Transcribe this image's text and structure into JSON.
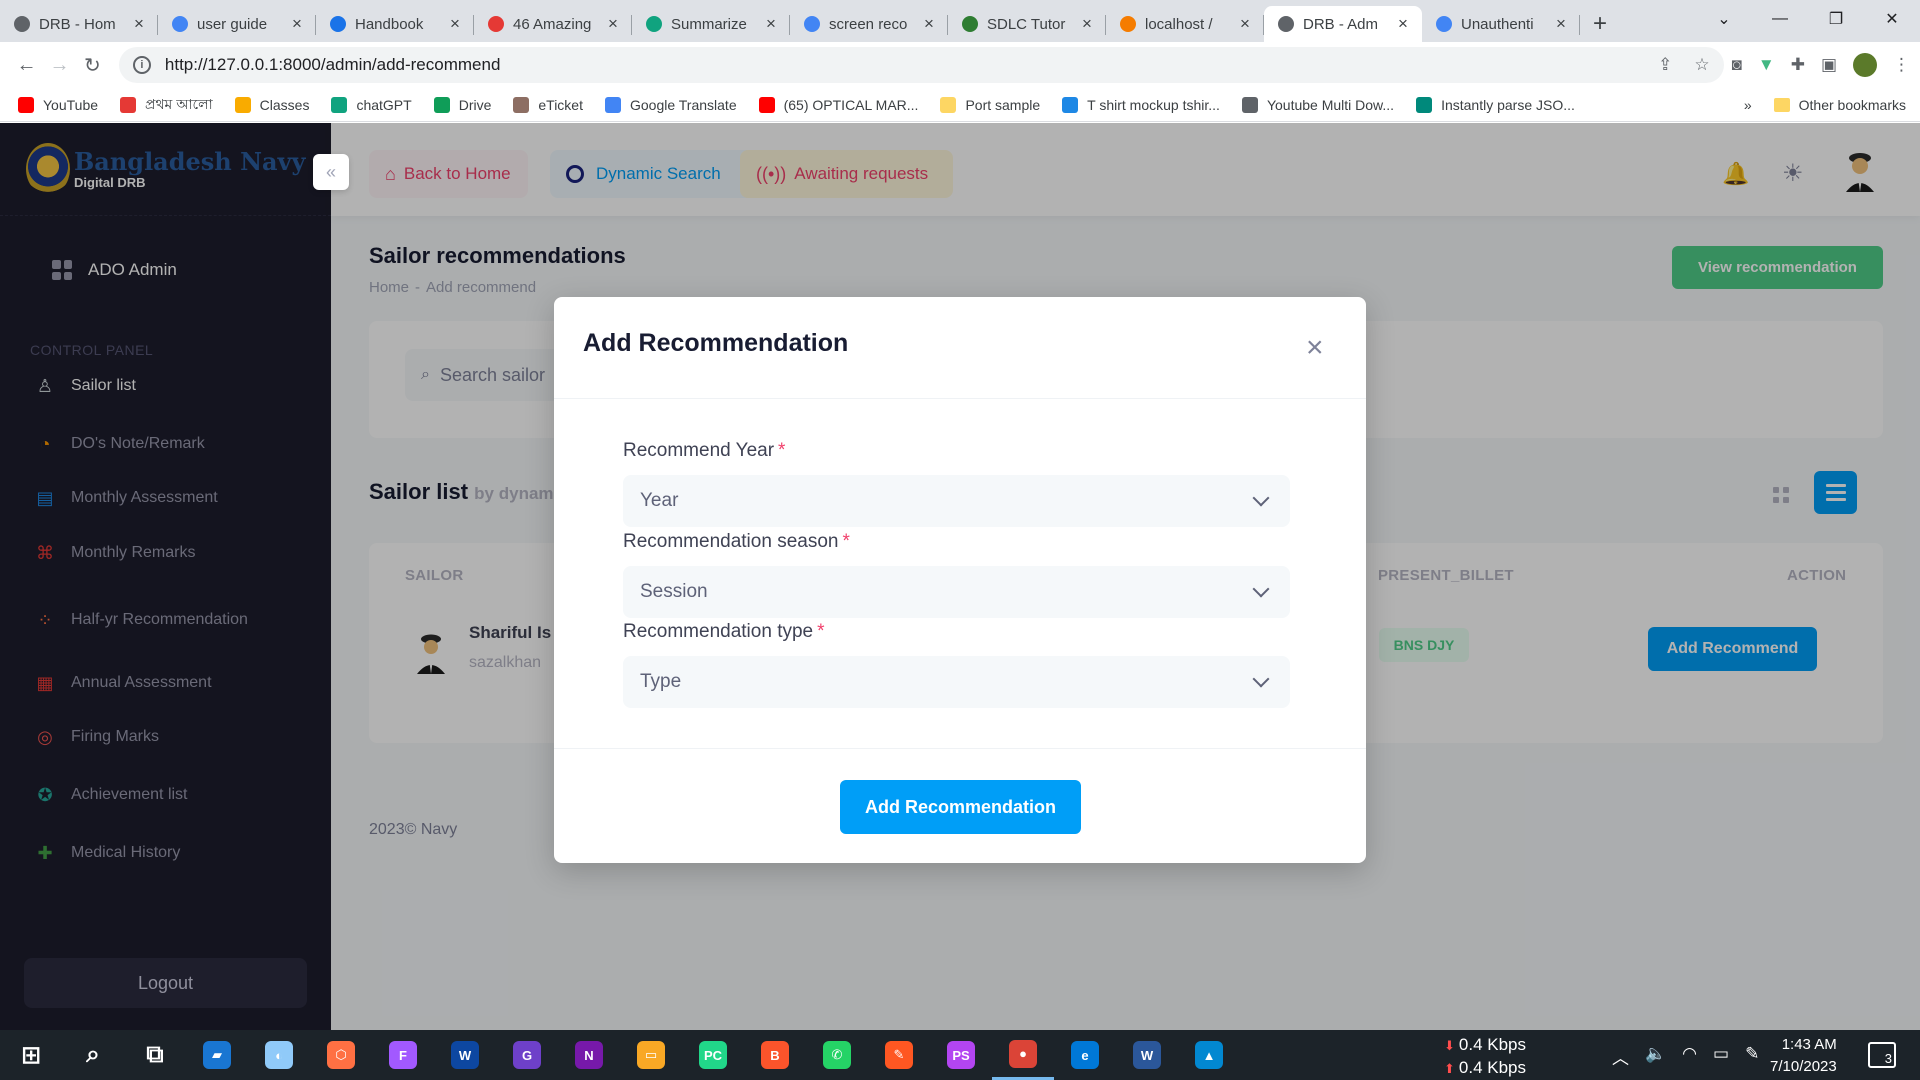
{
  "browser": {
    "tabs": [
      {
        "title": "DRB - Hom",
        "favicon": "globe-icon",
        "color": "#5f6368"
      },
      {
        "title": "user guide",
        "favicon": "google-icon",
        "color": "#4285f4"
      },
      {
        "title": "Handbook",
        "favicon": "table-icon",
        "color": "#1a73e8"
      },
      {
        "title": "46 Amazing",
        "favicon": "a-icon",
        "color": "#e53935"
      },
      {
        "title": "Summarize",
        "favicon": "chatgpt-icon",
        "color": "#10a37f"
      },
      {
        "title": "screen reco",
        "favicon": "google-icon",
        "color": "#4285f4"
      },
      {
        "title": "SDLC Tutor",
        "favicon": "leaf-icon",
        "color": "#2e7d32"
      },
      {
        "title": "localhost /",
        "favicon": "pma-icon",
        "color": "#f57c00"
      },
      {
        "title": "DRB - Adm",
        "favicon": "globe-icon",
        "color": "#5f6368"
      },
      {
        "title": "Unauthenti",
        "favicon": "google-icon",
        "color": "#4285f4"
      }
    ],
    "active_tab_index": 8,
    "url": "http://127.0.0.1:8000/admin/add-recommend",
    "bookmarks": [
      {
        "label": "YouTube",
        "icon": "youtube-icon",
        "color": "#ff0000"
      },
      {
        "label": "প্রথম আলো",
        "icon": "prothomalo-icon",
        "color": "#e53935"
      },
      {
        "label": "Classes",
        "icon": "classroom-icon",
        "color": "#f9ab00"
      },
      {
        "label": "chatGPT",
        "icon": "chatgpt-icon",
        "color": "#10a37f"
      },
      {
        "label": "Drive",
        "icon": "drive-icon",
        "color": "#0f9d58"
      },
      {
        "label": "eTicket",
        "icon": "ticket-icon",
        "color": "#8d6e63"
      },
      {
        "label": "Google Translate",
        "icon": "translate-icon",
        "color": "#4285f4"
      },
      {
        "label": "(65) OPTICAL MAR...",
        "icon": "youtube-icon",
        "color": "#ff0000"
      },
      {
        "label": "Port sample",
        "icon": "folder-icon",
        "color": "#fdd663"
      },
      {
        "label": "T shirt mockup tshir...",
        "icon": "shirt-icon",
        "color": "#1e88e5"
      },
      {
        "label": "Youtube Multi Dow...",
        "icon": "globe-icon",
        "color": "#5f6368"
      },
      {
        "label": "Instantly parse JSO...",
        "icon": "qt-icon",
        "color": "#00897b"
      }
    ],
    "more_bookmarks": "»",
    "other_bookmarks": "Other bookmarks"
  },
  "sidebar": {
    "brand_title": "Bangladesh Navy",
    "brand_subtitle": "Digital DRB",
    "dashboard_label": "ADO Admin",
    "section_label": "CONTROL PANEL",
    "items": [
      {
        "label": "Sailor list",
        "icon": "sailor-icon",
        "active": true
      },
      {
        "label": "DO's Note/Remark",
        "icon": "rss-icon"
      },
      {
        "label": "Monthly Assessment",
        "icon": "chart-icon"
      },
      {
        "label": "Monthly Remarks",
        "icon": "command-icon"
      },
      {
        "label": "Half-yr Recommendation",
        "icon": "dots-icon"
      },
      {
        "label": "Annual Assessment",
        "icon": "calendar-icon"
      },
      {
        "label": "Firing Marks",
        "icon": "target-icon"
      },
      {
        "label": "Achievement list",
        "icon": "medal-icon"
      },
      {
        "label": "Medical History",
        "icon": "medical-icon"
      }
    ],
    "logout_label": "Logout"
  },
  "header": {
    "back_label": "Back to Home",
    "dynamic_search_label": "Dynamic Search",
    "awaiting_label": "Awaiting requests"
  },
  "page": {
    "title": "Sailor recommendations",
    "breadcrumb_home": "Home",
    "breadcrumb_sep": "-",
    "breadcrumb_current": "Add recommend",
    "view_recommendation_label": "View recommendation",
    "search_placeholder": "Search sailor",
    "list_title": "Sailor list",
    "list_subtitle": "by dynam",
    "columns": {
      "sailor": "SAILOR",
      "present_billet": "PRESENT_BILLET",
      "action": "ACTION"
    },
    "rows": [
      {
        "name": "Shariful Is",
        "sub": "sazalkhan",
        "billet": "BNS DJY",
        "action": "Add Recommend"
      }
    ],
    "footer": "2023© Navy"
  },
  "modal": {
    "title": "Add Recommendation",
    "close": "×",
    "fields": [
      {
        "label": "Recommend Year",
        "required": "*",
        "value": "Year"
      },
      {
        "label": "Recommendation season",
        "required": "*",
        "value": "Session"
      },
      {
        "label": "Recommendation type",
        "required": "*",
        "value": "Type"
      }
    ],
    "submit_label": "Add Recommendation"
  },
  "taskbar": {
    "apps": [
      {
        "name": "start-icon",
        "glyph": "⊞",
        "color": "transparent"
      },
      {
        "name": "search-icon",
        "glyph": "⌕",
        "color": "transparent"
      },
      {
        "name": "task-view-icon",
        "glyph": "⧉",
        "color": "transparent"
      },
      {
        "name": "app-1-icon",
        "glyph": "▰",
        "color": "#1976d2"
      },
      {
        "name": "app-2-icon",
        "glyph": "◐",
        "color": "#90caf9"
      },
      {
        "name": "app-3-icon",
        "glyph": "⬡",
        "color": "#ff7043"
      },
      {
        "name": "figma-icon",
        "glyph": "F",
        "color": "#a259ff"
      },
      {
        "name": "app-4-icon",
        "glyph": "W",
        "color": "#0d47a1"
      },
      {
        "name": "github-icon",
        "glyph": "G",
        "color": "#6e40c9"
      },
      {
        "name": "onenote-icon",
        "glyph": "N",
        "color": "#7719aa"
      },
      {
        "name": "file-explorer-icon",
        "glyph": "▭",
        "color": "#f9a825"
      },
      {
        "name": "pycharm-icon",
        "glyph": "PC",
        "color": "#21d789"
      },
      {
        "name": "brave-icon",
        "glyph": "B",
        "color": "#fb542b"
      },
      {
        "name": "whatsapp-icon",
        "glyph": "✆",
        "color": "#25d366"
      },
      {
        "name": "app-5-icon",
        "glyph": "✎",
        "color": "#ff5722"
      },
      {
        "name": "phpstorm-icon",
        "glyph": "PS",
        "color": "#b345f1"
      },
      {
        "name": "chrome-icon",
        "glyph": "●",
        "color": "#db4437"
      },
      {
        "name": "edge-icon",
        "glyph": "e",
        "color": "#0078d7"
      },
      {
        "name": "word-icon",
        "glyph": "W",
        "color": "#2b579a"
      },
      {
        "name": "photos-icon",
        "glyph": "▲",
        "color": "#0288d1"
      }
    ],
    "net_down": "0.4 Kbps",
    "net_up": "0.4 Kbps",
    "time": "1:43 AM",
    "date": "7/10/2023",
    "notifications": "3"
  }
}
